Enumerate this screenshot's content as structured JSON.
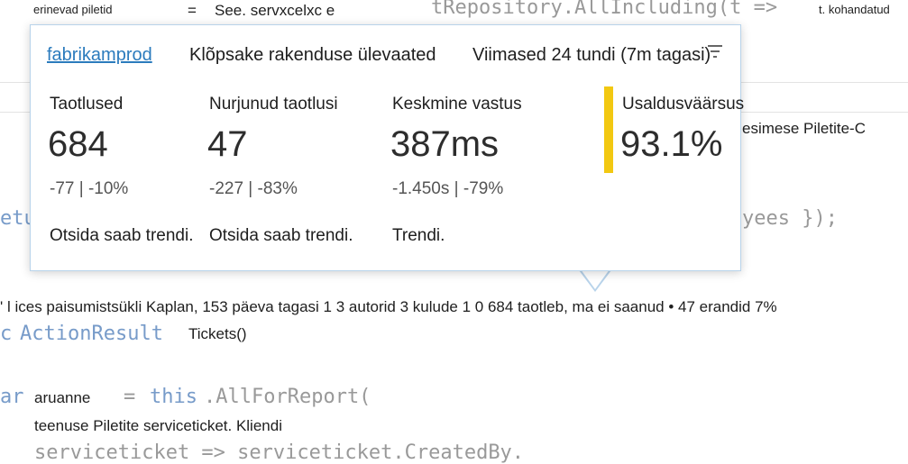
{
  "editor": {
    "top_left_hint": "erinevad piletid",
    "top_equals": "=",
    "top_mid_hint": "See. servxcelxc e",
    "top_code": "tRepository.AllIncluding(t =>",
    "top_right_hint": "t. kohandatud",
    "right_hint": "esimese Piletite-C",
    "left_code_fragment": "etu",
    "right_code_fragment": "yees });",
    "codelens_line": "' l ices paisumistsükli Kaplan, 153 päeva tagasi 1 3 autorid 3 kulude 1 0 684 taotleb, ma ei saanud • 47 erandid 7%",
    "action_prefix": "c",
    "action_keyword": "ActionResult",
    "action_name": "Tickets()",
    "var_prefix": "ar",
    "var_name": "aruanne",
    "assign": "=",
    "this_kw": "this",
    "all_for_report": ".AllForReport(",
    "service_line": "teenuse Piletite serviceticket. Kliendi",
    "bottom_code": "serviceticket => serviceticket.CreatedBy."
  },
  "popup": {
    "app_name": "fabrikamprod",
    "title": "Klõpsake rakenduse ülevaated",
    "time_range": "Viimased 24 tundi (7m tagasi)",
    "filter_icon": "filter-icon",
    "metrics": [
      {
        "label": "Taotlused",
        "value": "684",
        "delta": "-77 | -10%",
        "trend": "Otsida saab trendi."
      },
      {
        "label": "Nurjunud taotlusi",
        "value": "47",
        "delta": "-227 | -83%",
        "trend": "Otsida saab trendi."
      },
      {
        "label": "Keskmine vastus",
        "value": "387ms",
        "delta": "-1.450s | -79%",
        "trend": "Trendi."
      },
      {
        "label": "Usaldusväärsus",
        "value": "93.1%"
      }
    ],
    "reliability_bar_color": "#f2c811"
  }
}
